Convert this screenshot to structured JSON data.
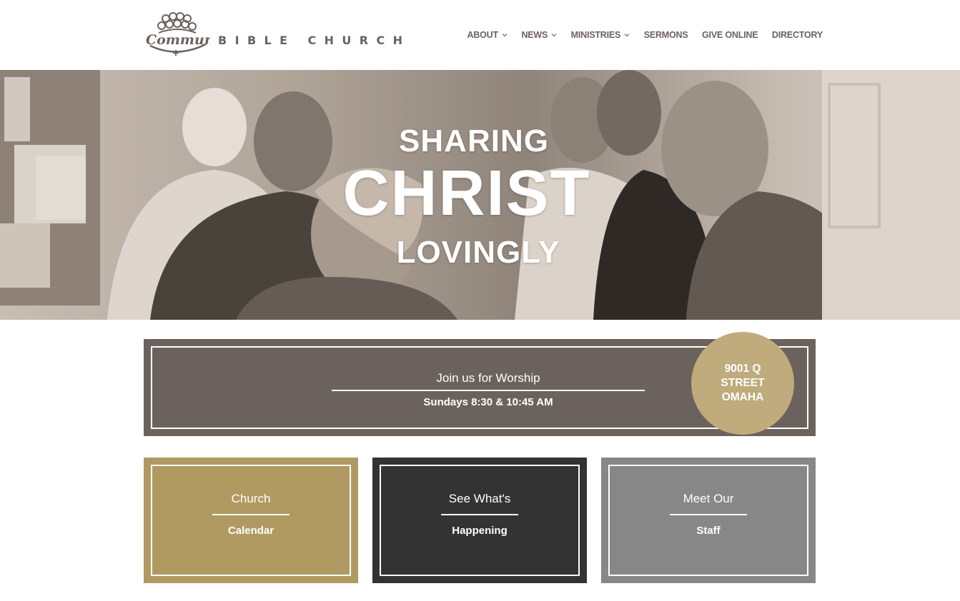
{
  "header": {
    "logo_script": "Community",
    "logo_text": "BIBLE CHURCH"
  },
  "nav": {
    "items": [
      {
        "label": "ABOUT",
        "has_dropdown": true
      },
      {
        "label": "NEWS",
        "has_dropdown": true
      },
      {
        "label": "MINISTRIES",
        "has_dropdown": true
      },
      {
        "label": "SERMONS",
        "has_dropdown": false
      },
      {
        "label": "GIVE ONLINE",
        "has_dropdown": false
      },
      {
        "label": "DIRECTORY",
        "has_dropdown": false
      }
    ]
  },
  "hero": {
    "line1": "SHARING",
    "line2": "CHRIST",
    "line3": "LOVINGLY"
  },
  "worship": {
    "title": "Join us for Worship",
    "times": "Sundays 8:30 & 10:45 AM",
    "address": "9001 Q STREET OMAHA"
  },
  "cards": [
    {
      "title": "Church",
      "sub": "Calendar",
      "color": "#b09a62"
    },
    {
      "title": "See What's",
      "sub": "Happening",
      "color": "#333333"
    },
    {
      "title": "Meet Our",
      "sub": "Staff",
      "color": "#878787"
    }
  ],
  "colors": {
    "brand_brown": "#6c625d",
    "accent_gold": "#bfab7c"
  }
}
